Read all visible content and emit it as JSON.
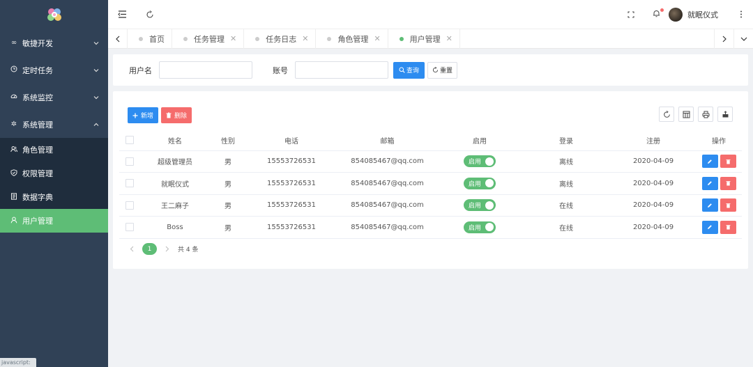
{
  "sidebar": {
    "items": [
      {
        "label": "敏捷开发",
        "icon": "infinity-icon"
      },
      {
        "label": "定时任务",
        "icon": "clock-icon"
      },
      {
        "label": "系统监控",
        "icon": "gauge-icon"
      },
      {
        "label": "系统管理",
        "icon": "gear-icon",
        "expanded": true
      }
    ],
    "subitems": [
      {
        "label": "角色管理",
        "icon": "users-icon"
      },
      {
        "label": "权限管理",
        "icon": "shield-icon"
      },
      {
        "label": "数据字典",
        "icon": "document-icon"
      },
      {
        "label": "用户管理",
        "icon": "user-icon",
        "active": true
      }
    ],
    "status_tip": "javascript:"
  },
  "header": {
    "user_name": "就眠仪式"
  },
  "tabs": [
    {
      "label": "首页",
      "closable": false
    },
    {
      "label": "任务管理",
      "closable": true
    },
    {
      "label": "任务日志",
      "closable": true
    },
    {
      "label": "角色管理",
      "closable": true
    },
    {
      "label": "用户管理",
      "closable": true,
      "active": true
    }
  ],
  "search": {
    "username_label": "用户名",
    "account_label": "账号",
    "query_label": "查询",
    "reset_label": "重置"
  },
  "toolbar": {
    "add_label": "新增",
    "delete_label": "删除"
  },
  "table": {
    "columns": [
      "姓名",
      "性别",
      "电话",
      "邮箱",
      "启用",
      "登录",
      "注册",
      "操作"
    ],
    "rows": [
      {
        "name": "超级管理员",
        "gender": "男",
        "phone": "15553726531",
        "email": "854085467@qq.com",
        "enabled": "启用",
        "login": "离线",
        "registered": "2020-04-09"
      },
      {
        "name": "就眠仪式",
        "gender": "男",
        "phone": "15553726531",
        "email": "854085467@qq.com",
        "enabled": "启用",
        "login": "离线",
        "registered": "2020-04-09"
      },
      {
        "name": "王二麻子",
        "gender": "男",
        "phone": "15553726531",
        "email": "854085467@qq.com",
        "enabled": "启用",
        "login": "在线",
        "registered": "2020-04-09"
      },
      {
        "name": "Boss",
        "gender": "男",
        "phone": "15553726531",
        "email": "854085467@qq.com",
        "enabled": "启用",
        "login": "在线",
        "registered": "2020-04-09"
      }
    ]
  },
  "pagination": {
    "current_page": "1",
    "total_text": "共 4 条"
  },
  "colors": {
    "sidebar_bg": "#304156",
    "submenu_bg": "#1f2d3d",
    "accent_green": "#5ebd76",
    "primary_blue": "#2d8cf0",
    "danger_red": "#f56c6c"
  }
}
